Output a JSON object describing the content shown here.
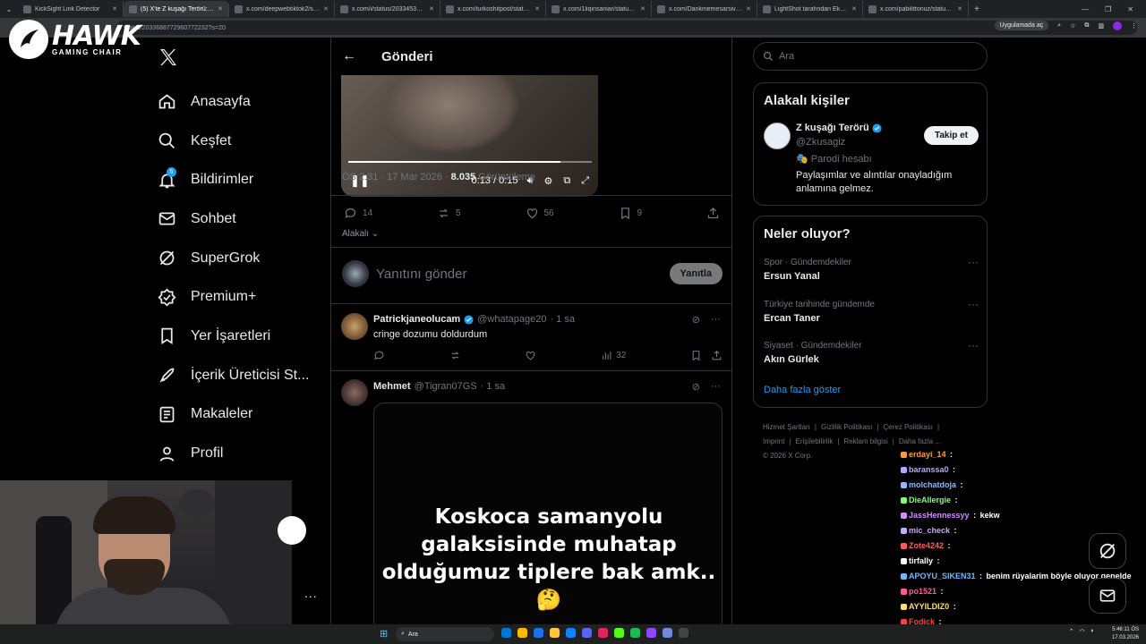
{
  "browser": {
    "tabs": [
      {
        "title": "KickSight Link Detector",
        "active": false
      },
      {
        "title": "(5) X'te Z kuşağı Terörü: \"B...",
        "active": true
      },
      {
        "title": "x.com/deepwebtiktok2/status/...",
        "active": false
      },
      {
        "title": "x.com/i/status/2033453475074...",
        "active": false
      },
      {
        "title": "x.com/turkoshitpost/status/203...",
        "active": false
      },
      {
        "title": "x.com/1liqinsaniar/status/203...",
        "active": false
      },
      {
        "title": "x.com/Dankmemesarsiv/status...",
        "active": false
      },
      {
        "title": "LightShot tarafından Ekran Gör...",
        "active": false
      },
      {
        "title": "x.com/pabilittonuz/status/203...",
        "active": false
      }
    ],
    "url": "status/2033688772960772232?s=20",
    "app_button": "Uygulamada aç"
  },
  "brand": {
    "name": "HAWK",
    "tagline": "GAMING CHAIR"
  },
  "nav": {
    "items": [
      {
        "label": "Anasayfa",
        "icon": "home-icon"
      },
      {
        "label": "Keşfet",
        "icon": "search-icon"
      },
      {
        "label": "Bildirimler",
        "icon": "bell-icon",
        "badge": "5"
      },
      {
        "label": "Sohbet",
        "icon": "mail-icon"
      },
      {
        "label": "SuperGrok",
        "icon": "grok-icon"
      },
      {
        "label": "Premium+",
        "icon": "verified-icon"
      },
      {
        "label": "Yer İşaretleri",
        "icon": "bookmark-icon"
      },
      {
        "label": "İçerik Üreticisi St...",
        "icon": "rocket-icon"
      },
      {
        "label": "Makaleler",
        "icon": "article-icon"
      },
      {
        "label": "Profil",
        "icon": "person-icon"
      }
    ],
    "more": "..."
  },
  "main": {
    "back": "←",
    "title": "Gönderi",
    "video": {
      "time": "0:13 / 0:15",
      "progress": 0.87
    },
    "meta": {
      "time": "ÖS 2:31 · 17 Mar 2026 · ",
      "views": "8.035",
      "views_label": " Görüntüleme"
    },
    "actions": {
      "replies": "14",
      "reposts": "5",
      "likes": "56",
      "bookmarks": "9"
    },
    "related": "Alakalı",
    "reply": {
      "placeholder": "Yanıtını gönder",
      "button": "Yanıtla"
    },
    "posts": [
      {
        "name": "Patrickjaneolucam",
        "handle": "@whatapage20",
        "time": "· 1 sa",
        "text": "cringe dozumu doldurdum",
        "views": "32"
      },
      {
        "name": "Mehmet",
        "handle": "@Tigran07GS",
        "time": "· 1 sa",
        "media_text": "Koskoca samanyolu galaksisinde muhatap olduğumuz tiplere bak amk..🤔"
      }
    ]
  },
  "right": {
    "search_placeholder": "Ara",
    "people_title": "Alakalı kişiler",
    "person": {
      "name": "Z kuşağı Terörü",
      "handle": "@Zkusagiz",
      "tag": "Parodi hesabı",
      "bio": "Paylaşımlar ve alıntılar onayladığım anlamına gelmez.",
      "follow": "Takip et"
    },
    "trends_title": "Neler oluyor?",
    "trends": [
      {
        "context": "Spor · Gündemdekiler",
        "name": "Ersun Yanal"
      },
      {
        "context": "Türkiye tarihinde gündemde",
        "name": "Ercan Taner"
      },
      {
        "context": "Siyaset · Gündemdekiler",
        "name": "Akın Gürlek"
      }
    ],
    "show_more": "Daha fazla göster",
    "footer": [
      "Hizmet Şartları",
      "Gizlilik Politikası",
      "Çerez Politikası",
      "Imprint",
      "Erişilebilirlik",
      "Reklam bilgisi",
      "Daha fazla ...",
      "© 2026 X Corp."
    ]
  },
  "chat": [
    {
      "user": "erdayi_14",
      "msg": "",
      "color": "#ff9b3d"
    },
    {
      "user": "baranssa0",
      "msg": "",
      "color": "#b4a7ff"
    },
    {
      "user": "molchatdoja",
      "msg": "",
      "color": "#8fb8ff"
    },
    {
      "user": "DieAllergie",
      "msg": "",
      "color": "#7dff7d"
    },
    {
      "user": "JassHennessyy",
      "msg": "kekw",
      "color": "#d38cff"
    },
    {
      "user": "mic_check",
      "msg": "",
      "color": "#c8a7ff"
    },
    {
      "user": "Zote4242",
      "msg": "",
      "color": "#ff5a5a"
    },
    {
      "user": "tirfally",
      "msg": "",
      "color": "#ffffff"
    },
    {
      "user": "APOYU_SIKEN31",
      "msg": "benim rüyalarim böyle oluyor genelde",
      "color": "#6cb8ff"
    },
    {
      "user": "po1521",
      "msg": "",
      "color": "#ff5a9a"
    },
    {
      "user": "AYYILDIZ0",
      "msg": "",
      "color": "#ffe066"
    },
    {
      "user": "Fodick",
      "msg": "",
      "color": "#ff4040"
    }
  ],
  "taskbar": {
    "search": "Ara",
    "time": "5:46:11 ÖS",
    "date": "17.03.2026"
  }
}
